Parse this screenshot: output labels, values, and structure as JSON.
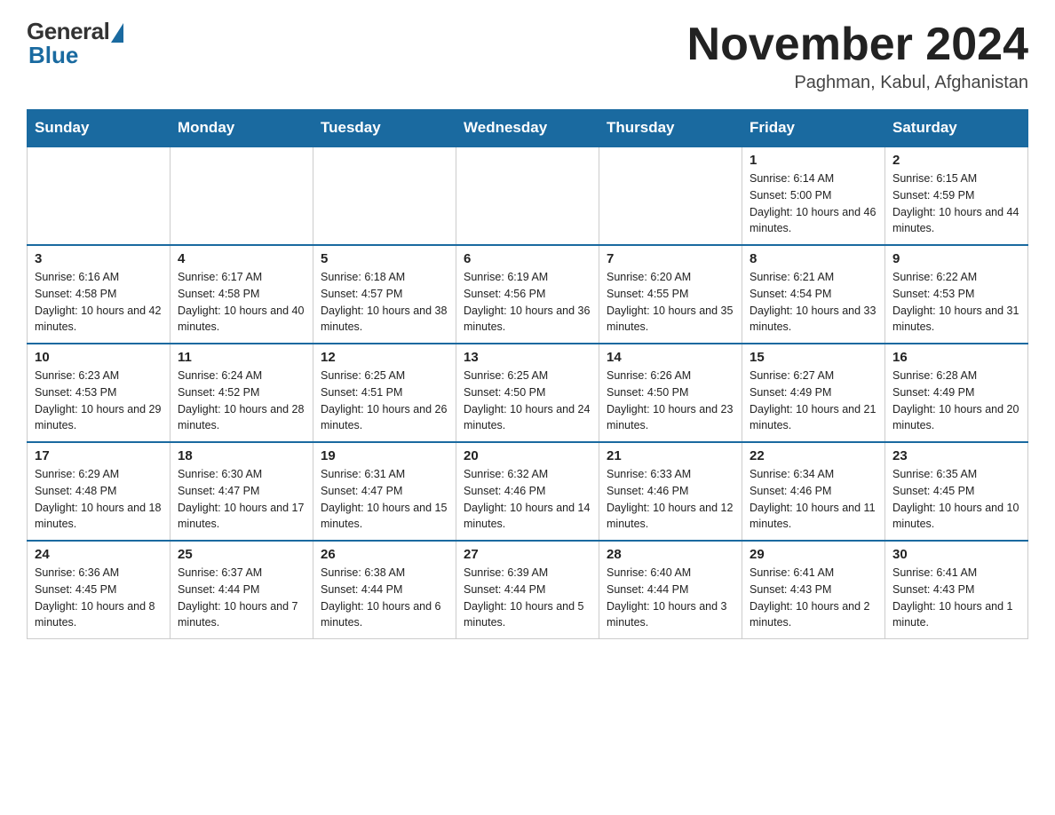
{
  "header": {
    "title": "November 2024",
    "location": "Paghman, Kabul, Afghanistan",
    "logo": {
      "general": "General",
      "blue": "Blue"
    }
  },
  "days_of_week": [
    "Sunday",
    "Monday",
    "Tuesday",
    "Wednesday",
    "Thursday",
    "Friday",
    "Saturday"
  ],
  "weeks": [
    [
      {
        "day": "",
        "info": ""
      },
      {
        "day": "",
        "info": ""
      },
      {
        "day": "",
        "info": ""
      },
      {
        "day": "",
        "info": ""
      },
      {
        "day": "",
        "info": ""
      },
      {
        "day": "1",
        "info": "Sunrise: 6:14 AM\nSunset: 5:00 PM\nDaylight: 10 hours and 46 minutes."
      },
      {
        "day": "2",
        "info": "Sunrise: 6:15 AM\nSunset: 4:59 PM\nDaylight: 10 hours and 44 minutes."
      }
    ],
    [
      {
        "day": "3",
        "info": "Sunrise: 6:16 AM\nSunset: 4:58 PM\nDaylight: 10 hours and 42 minutes."
      },
      {
        "day": "4",
        "info": "Sunrise: 6:17 AM\nSunset: 4:58 PM\nDaylight: 10 hours and 40 minutes."
      },
      {
        "day": "5",
        "info": "Sunrise: 6:18 AM\nSunset: 4:57 PM\nDaylight: 10 hours and 38 minutes."
      },
      {
        "day": "6",
        "info": "Sunrise: 6:19 AM\nSunset: 4:56 PM\nDaylight: 10 hours and 36 minutes."
      },
      {
        "day": "7",
        "info": "Sunrise: 6:20 AM\nSunset: 4:55 PM\nDaylight: 10 hours and 35 minutes."
      },
      {
        "day": "8",
        "info": "Sunrise: 6:21 AM\nSunset: 4:54 PM\nDaylight: 10 hours and 33 minutes."
      },
      {
        "day": "9",
        "info": "Sunrise: 6:22 AM\nSunset: 4:53 PM\nDaylight: 10 hours and 31 minutes."
      }
    ],
    [
      {
        "day": "10",
        "info": "Sunrise: 6:23 AM\nSunset: 4:53 PM\nDaylight: 10 hours and 29 minutes."
      },
      {
        "day": "11",
        "info": "Sunrise: 6:24 AM\nSunset: 4:52 PM\nDaylight: 10 hours and 28 minutes."
      },
      {
        "day": "12",
        "info": "Sunrise: 6:25 AM\nSunset: 4:51 PM\nDaylight: 10 hours and 26 minutes."
      },
      {
        "day": "13",
        "info": "Sunrise: 6:25 AM\nSunset: 4:50 PM\nDaylight: 10 hours and 24 minutes."
      },
      {
        "day": "14",
        "info": "Sunrise: 6:26 AM\nSunset: 4:50 PM\nDaylight: 10 hours and 23 minutes."
      },
      {
        "day": "15",
        "info": "Sunrise: 6:27 AM\nSunset: 4:49 PM\nDaylight: 10 hours and 21 minutes."
      },
      {
        "day": "16",
        "info": "Sunrise: 6:28 AM\nSunset: 4:49 PM\nDaylight: 10 hours and 20 minutes."
      }
    ],
    [
      {
        "day": "17",
        "info": "Sunrise: 6:29 AM\nSunset: 4:48 PM\nDaylight: 10 hours and 18 minutes."
      },
      {
        "day": "18",
        "info": "Sunrise: 6:30 AM\nSunset: 4:47 PM\nDaylight: 10 hours and 17 minutes."
      },
      {
        "day": "19",
        "info": "Sunrise: 6:31 AM\nSunset: 4:47 PM\nDaylight: 10 hours and 15 minutes."
      },
      {
        "day": "20",
        "info": "Sunrise: 6:32 AM\nSunset: 4:46 PM\nDaylight: 10 hours and 14 minutes."
      },
      {
        "day": "21",
        "info": "Sunrise: 6:33 AM\nSunset: 4:46 PM\nDaylight: 10 hours and 12 minutes."
      },
      {
        "day": "22",
        "info": "Sunrise: 6:34 AM\nSunset: 4:46 PM\nDaylight: 10 hours and 11 minutes."
      },
      {
        "day": "23",
        "info": "Sunrise: 6:35 AM\nSunset: 4:45 PM\nDaylight: 10 hours and 10 minutes."
      }
    ],
    [
      {
        "day": "24",
        "info": "Sunrise: 6:36 AM\nSunset: 4:45 PM\nDaylight: 10 hours and 8 minutes."
      },
      {
        "day": "25",
        "info": "Sunrise: 6:37 AM\nSunset: 4:44 PM\nDaylight: 10 hours and 7 minutes."
      },
      {
        "day": "26",
        "info": "Sunrise: 6:38 AM\nSunset: 4:44 PM\nDaylight: 10 hours and 6 minutes."
      },
      {
        "day": "27",
        "info": "Sunrise: 6:39 AM\nSunset: 4:44 PM\nDaylight: 10 hours and 5 minutes."
      },
      {
        "day": "28",
        "info": "Sunrise: 6:40 AM\nSunset: 4:44 PM\nDaylight: 10 hours and 3 minutes."
      },
      {
        "day": "29",
        "info": "Sunrise: 6:41 AM\nSunset: 4:43 PM\nDaylight: 10 hours and 2 minutes."
      },
      {
        "day": "30",
        "info": "Sunrise: 6:41 AM\nSunset: 4:43 PM\nDaylight: 10 hours and 1 minute."
      }
    ]
  ]
}
